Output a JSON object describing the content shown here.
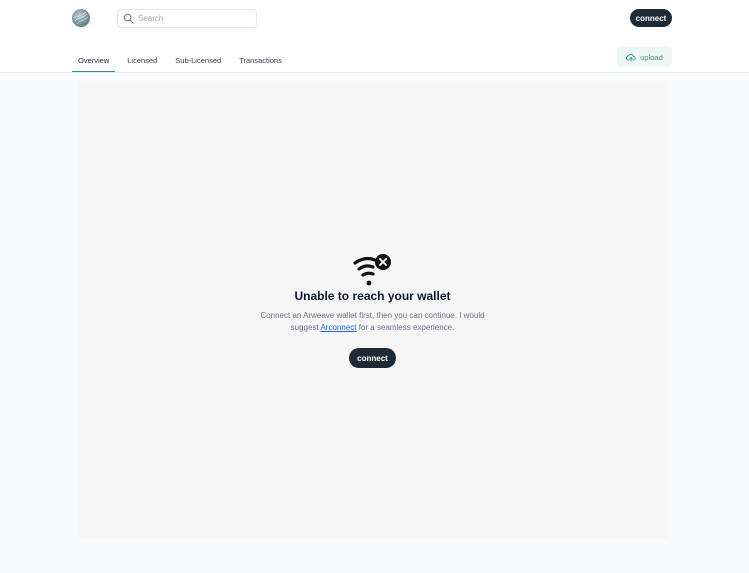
{
  "header": {
    "search": {
      "placeholder": "Search",
      "value": ""
    },
    "connect_label": "connect"
  },
  "tabs": [
    {
      "label": "Overview",
      "active": true
    },
    {
      "label": "Licensed",
      "active": false
    },
    {
      "label": "Sub-Licensed",
      "active": false
    },
    {
      "label": "Transactions",
      "active": false
    }
  ],
  "upload_label": "upload",
  "empty_state": {
    "icon": "wifi-off-icon",
    "title": "Unable to reach your wallet",
    "desc_before": "Connect an Arweave wallet first, then you can continue. I would suggest ",
    "link_text": "Arconnect",
    "desc_after": " for a seamless experience.",
    "button_label": "connect"
  },
  "colors": {
    "accent": "#2c8f84",
    "dark_button": "#1f2a37",
    "upload_bg": "#ebf8f4",
    "upload_text": "#2d9a85",
    "link": "#2563eb"
  }
}
